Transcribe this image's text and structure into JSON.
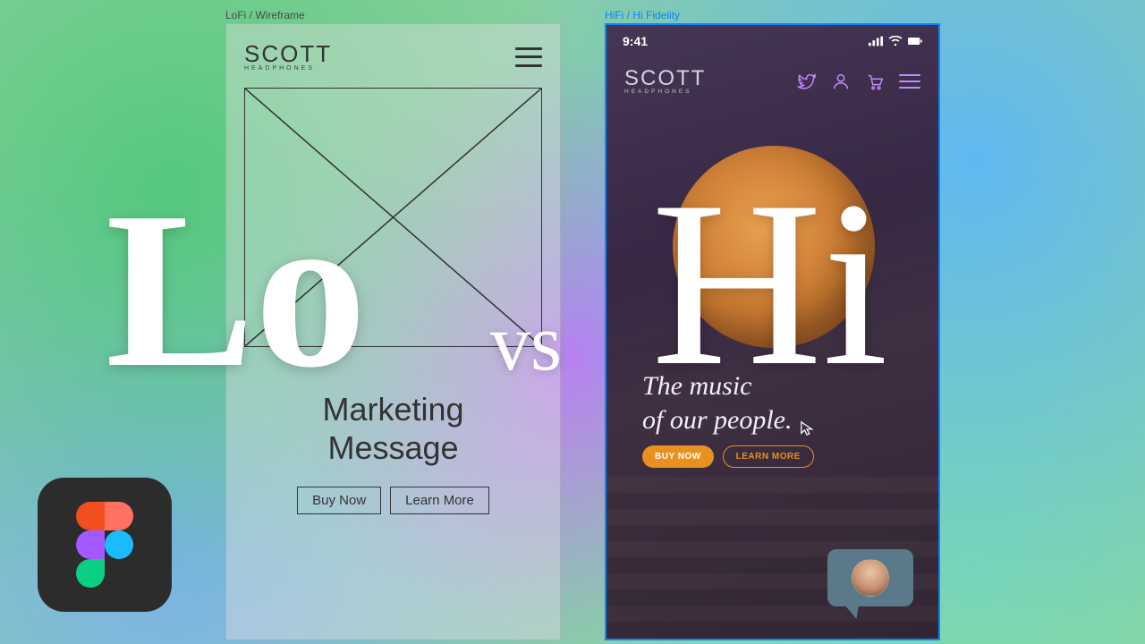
{
  "frames": {
    "lofi_label": "LoFi / Wireframe",
    "hifi_label": "HiFi / Hi Fidelity"
  },
  "brand": {
    "name": "SCOTT",
    "subtitle": "HEADPHONES"
  },
  "lofi": {
    "heading_line1": "Marketing",
    "heading_line2": "Message",
    "buy_label": "Buy Now",
    "learn_label": "Learn More"
  },
  "hifi": {
    "status_time": "9:41",
    "heading_line1": "The music",
    "heading_line2": "of our people.",
    "buy_label": "BUY NOW",
    "learn_label": "LEARN MORE"
  },
  "overlay": {
    "lo": "Lo",
    "vs": "vs",
    "hi": "Hi"
  }
}
